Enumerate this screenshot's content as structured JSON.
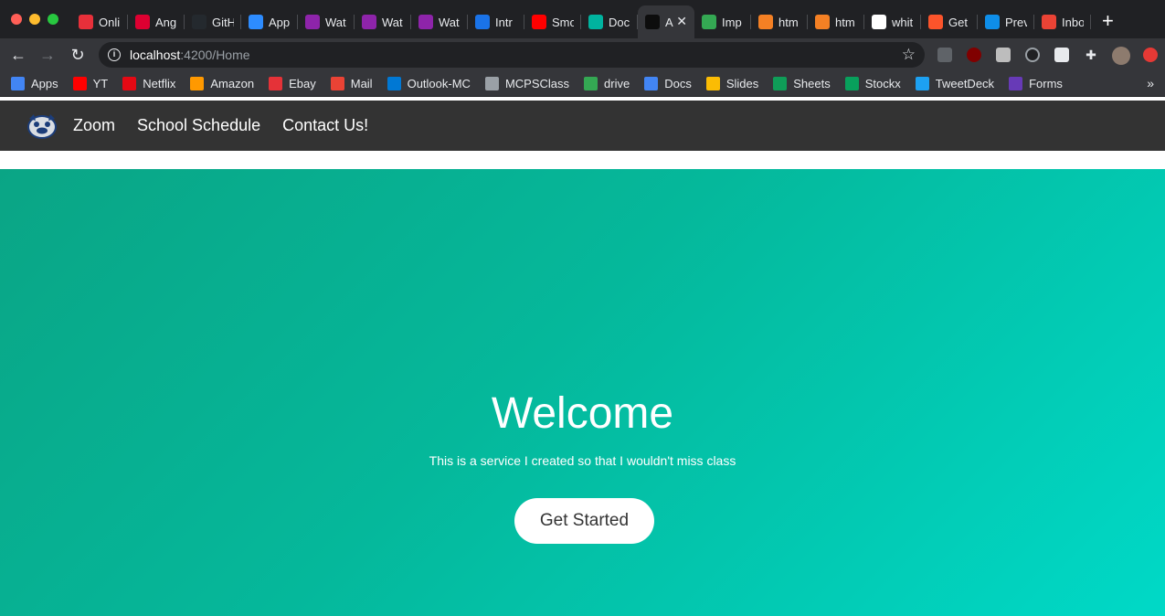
{
  "browser": {
    "tabs": [
      {
        "label": "Onli",
        "icon": "red-diagonal-icon",
        "color": "#e8303a"
      },
      {
        "label": "Ang",
        "icon": "angular-icon",
        "color": "#dd0031"
      },
      {
        "label": "GitH",
        "icon": "github-icon",
        "color": "#24292e"
      },
      {
        "label": "App",
        "icon": "zoom-icon",
        "color": "#2d8cff"
      },
      {
        "label": "Wat",
        "icon": "play-icon",
        "color": "#8e24aa"
      },
      {
        "label": "Wat",
        "icon": "play-icon",
        "color": "#8e24aa"
      },
      {
        "label": "Wat",
        "icon": "play-icon",
        "color": "#8e24aa"
      },
      {
        "label": "Intr",
        "icon": "c-icon",
        "color": "#1a73e8"
      },
      {
        "label": "Smo",
        "icon": "youtube-icon",
        "color": "#ff0000"
      },
      {
        "label": "Doc",
        "icon": "bitbucket-icon",
        "color": "#00b39f"
      },
      {
        "label": "A",
        "icon": "angular-dark-icon",
        "color": "#0d0d0d",
        "active": true
      },
      {
        "label": "Imp",
        "icon": "drive-icon",
        "color": "#34a853"
      },
      {
        "label": "htm",
        "icon": "stackoverflow-icon",
        "color": "#f48024"
      },
      {
        "label": "htm",
        "icon": "stackoverflow-icon",
        "color": "#f48024"
      },
      {
        "label": "whit",
        "icon": "google-icon",
        "color": "#ffffff"
      },
      {
        "label": "Get",
        "icon": "brave-icon",
        "color": "#fb542b"
      },
      {
        "label": "Prev",
        "icon": "teamviewer-icon",
        "color": "#0e8ee9"
      },
      {
        "label": "Inbo",
        "icon": "gmail-icon",
        "color": "#ea4335"
      }
    ],
    "url_host": "localhost",
    "url_path": ":4200/Home",
    "bookmarks": [
      {
        "label": "Apps",
        "icon": "apps-grid-icon",
        "color": "#4285f4"
      },
      {
        "label": "YT",
        "icon": "youtube-icon",
        "color": "#ff0000"
      },
      {
        "label": "Netflix",
        "icon": "netflix-icon",
        "color": "#e50914"
      },
      {
        "label": "Amazon",
        "icon": "amazon-icon",
        "color": "#ff9900"
      },
      {
        "label": "Ebay",
        "icon": "ebay-icon",
        "color": "#e53238"
      },
      {
        "label": "Mail",
        "icon": "gmail-icon",
        "color": "#ea4335"
      },
      {
        "label": "Outlook-MC",
        "icon": "outlook-icon",
        "color": "#0078d4"
      },
      {
        "label": "MCPSClass",
        "icon": "globe-icon",
        "color": "#9aa0a6"
      },
      {
        "label": "drive",
        "icon": "drive-icon",
        "color": "#34a853"
      },
      {
        "label": "Docs",
        "icon": "docs-icon",
        "color": "#4285f4"
      },
      {
        "label": "Slides",
        "icon": "slides-icon",
        "color": "#fbbc04"
      },
      {
        "label": "Sheets",
        "icon": "sheets-icon",
        "color": "#0f9d58"
      },
      {
        "label": "Stockx",
        "icon": "stockx-icon",
        "color": "#08a05c"
      },
      {
        "label": "TweetDeck",
        "icon": "twitter-icon",
        "color": "#1da1f2"
      },
      {
        "label": "Forms",
        "icon": "forms-icon",
        "color": "#673ab7"
      }
    ]
  },
  "app": {
    "nav": {
      "links": [
        "Zoom",
        "School Schedule",
        "Contact Us!"
      ]
    },
    "hero": {
      "title": "Welcome",
      "subtitle": "This is a service I created so that I wouldn't miss class",
      "cta": "Get Started"
    }
  }
}
